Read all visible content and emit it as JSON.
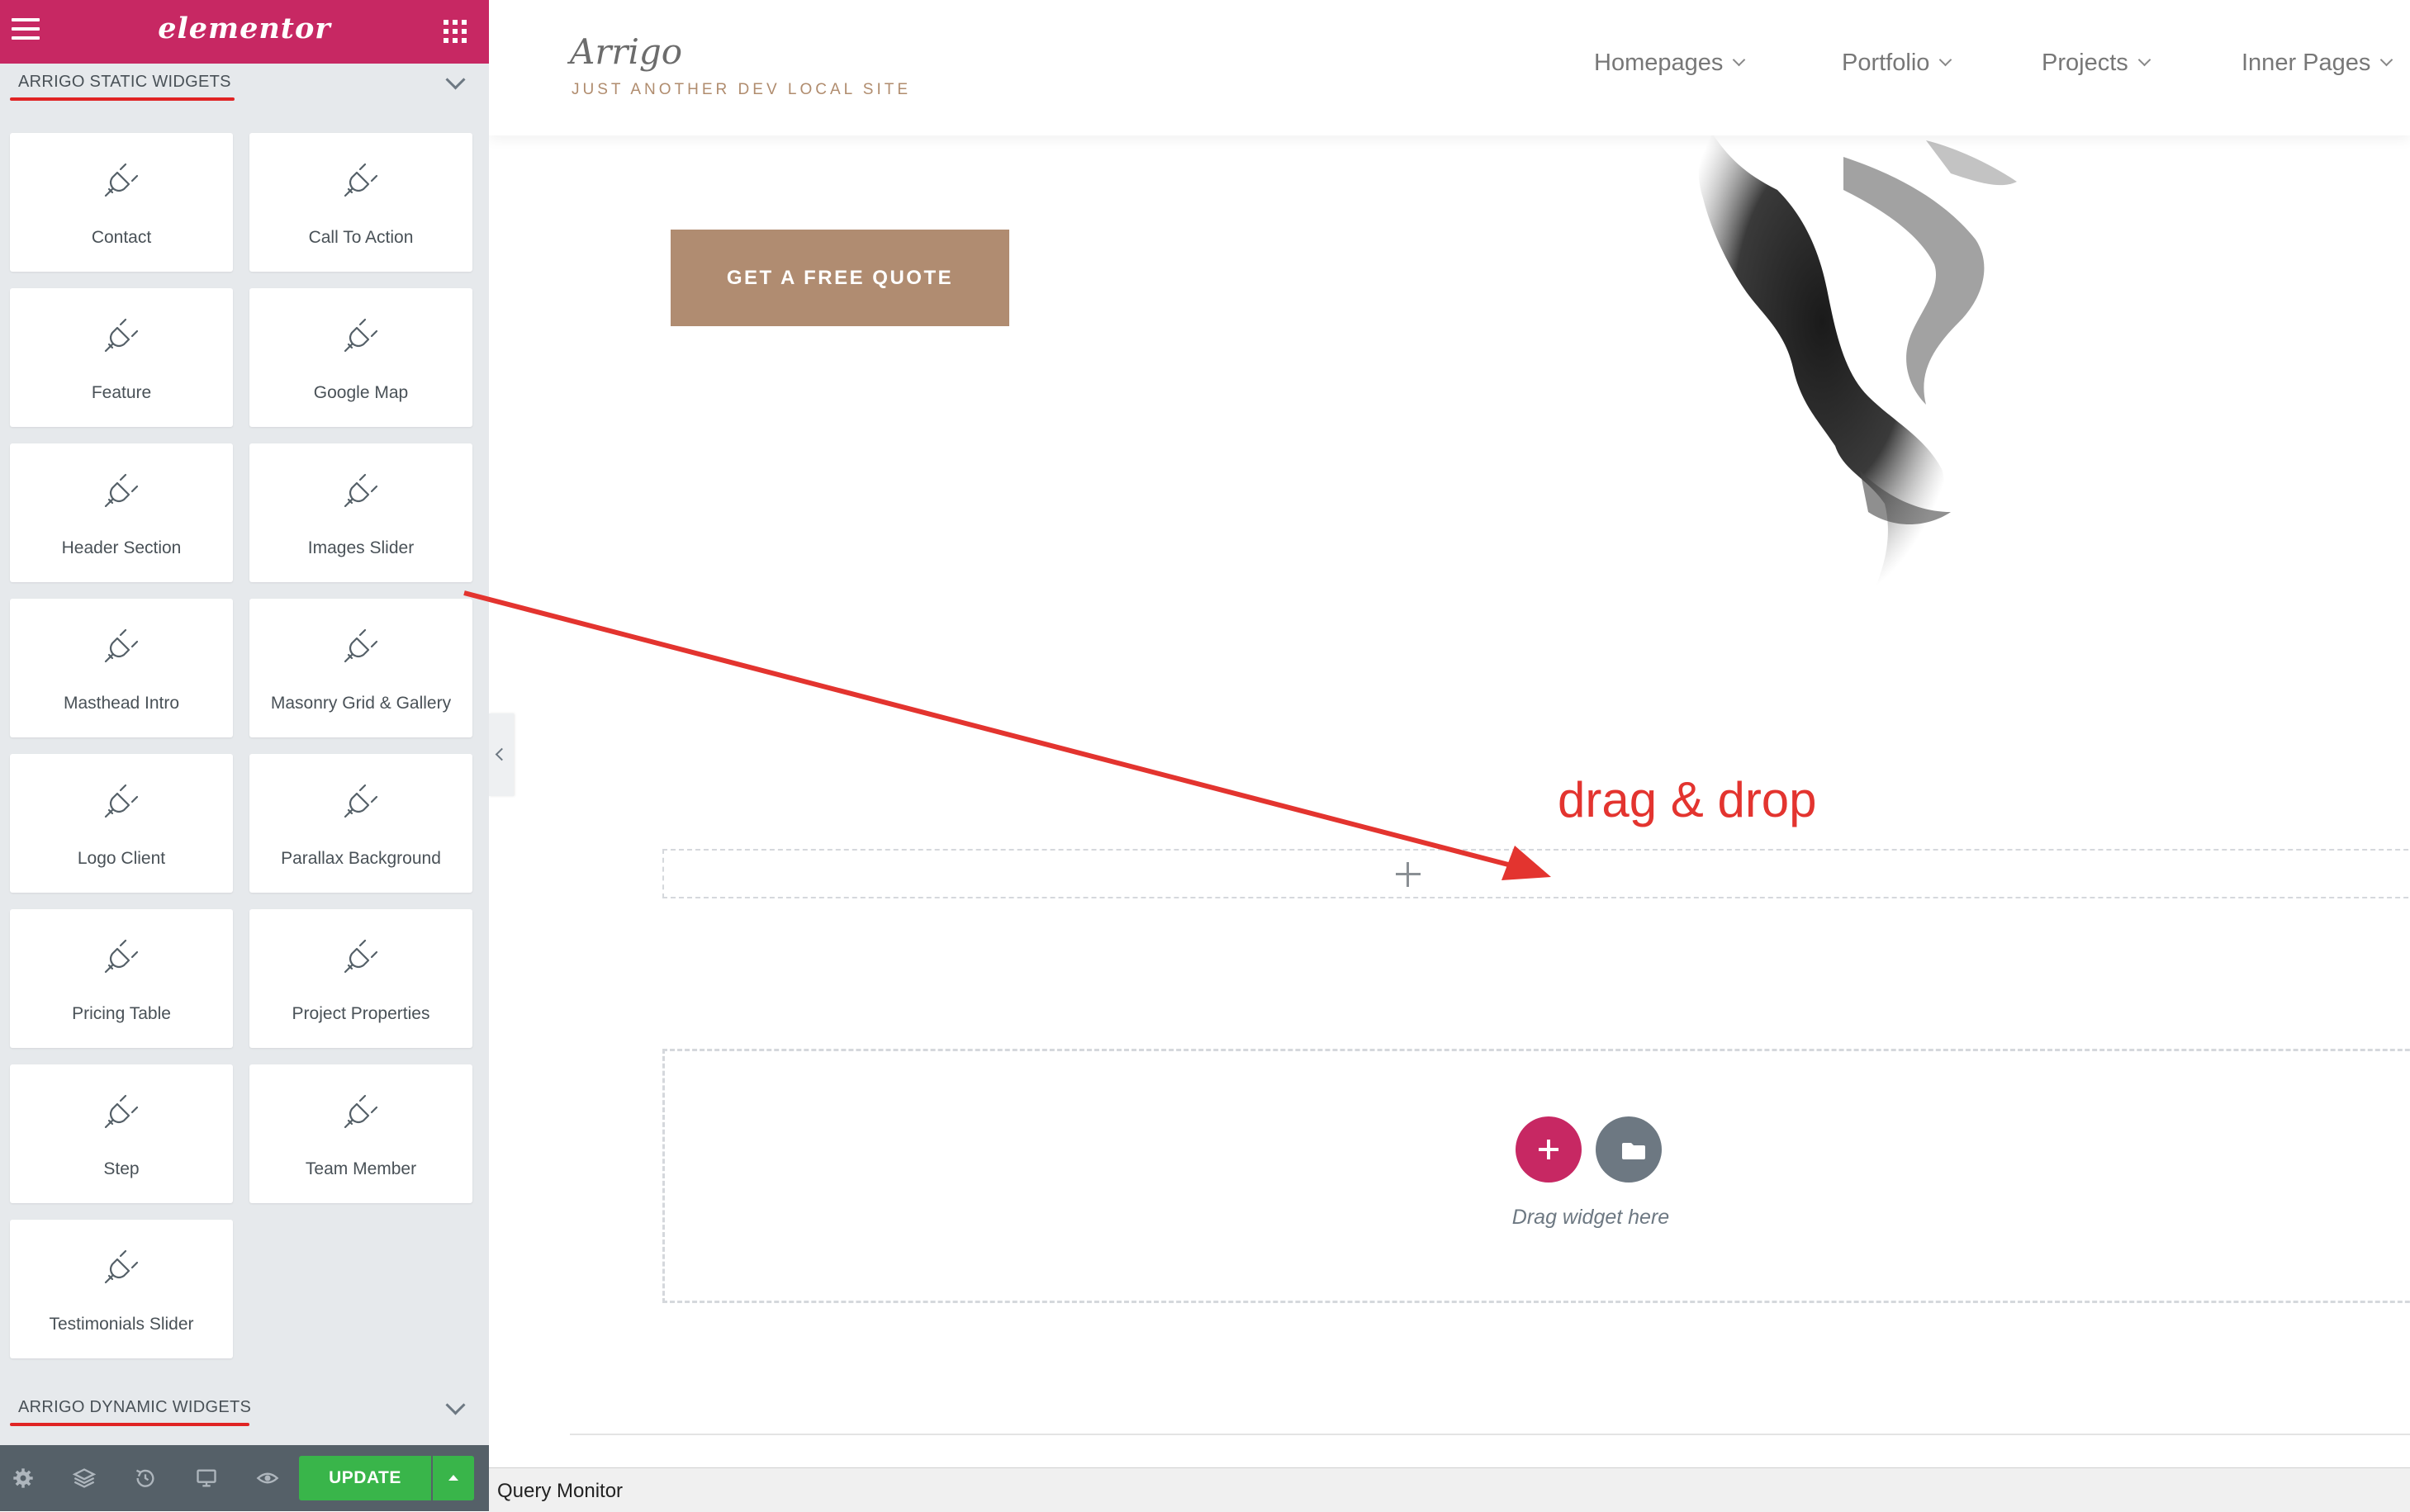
{
  "panel": {
    "brand": "elementor",
    "static_category": "ARRIGO STATIC WIDGETS",
    "dynamic_category": "ARRIGO DYNAMIC WIDGETS",
    "widgets": [
      {
        "label": "Contact",
        "icon": "plug-icon"
      },
      {
        "label": "Call To Action",
        "icon": "plug-icon"
      },
      {
        "label": "Feature",
        "icon": "plug-icon"
      },
      {
        "label": "Google Map",
        "icon": "plug-icon"
      },
      {
        "label": "Header Section",
        "icon": "plug-icon"
      },
      {
        "label": "Images Slider",
        "icon": "plug-icon"
      },
      {
        "label": "Masthead Intro",
        "icon": "plug-icon"
      },
      {
        "label": "Masonry Grid & Gallery",
        "icon": "plug-icon"
      },
      {
        "label": "Logo Client",
        "icon": "plug-icon"
      },
      {
        "label": "Parallax Background",
        "icon": "plug-icon"
      },
      {
        "label": "Pricing Table",
        "icon": "plug-icon"
      },
      {
        "label": "Project Properties",
        "icon": "plug-icon"
      },
      {
        "label": "Step",
        "icon": "plug-icon"
      },
      {
        "label": "Team Member",
        "icon": "plug-icon"
      },
      {
        "label": "Testimonials Slider",
        "icon": "plug-icon"
      }
    ],
    "footer": {
      "icons": [
        "gear-icon",
        "layers-icon",
        "history-icon",
        "desktop-icon",
        "eye-icon"
      ],
      "update_label": "UPDATE"
    }
  },
  "site": {
    "title": "Arrigo",
    "tagline": "JUST ANOTHER DEV LOCAL SITE",
    "nav": [
      "Homepages",
      "Portfolio",
      "Projects",
      "Inner Pages"
    ],
    "cta": "GET A FREE QUOTE"
  },
  "canvas": {
    "annotation": "drag & drop",
    "drag_hint": "Drag widget here"
  },
  "query_monitor": "Query Monitor",
  "colors": {
    "elementor_pink": "#c72863",
    "panel_bg": "#e6e9ec",
    "update_green": "#39b54a",
    "annotation_red": "#e3342f",
    "cta_tan": "#b08c71"
  }
}
